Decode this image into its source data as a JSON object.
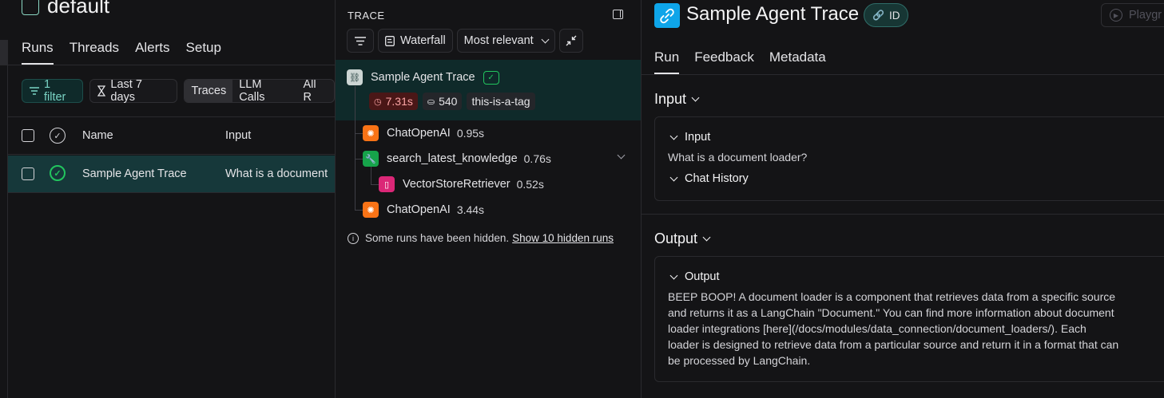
{
  "project": {
    "name": "default"
  },
  "left_tabs": [
    "Runs",
    "Threads",
    "Alerts",
    "Setup"
  ],
  "filters": {
    "filter_label": "1 filter",
    "date_label": "Last 7 days",
    "segments": [
      "Traces",
      "LLM Calls",
      "All R"
    ]
  },
  "table": {
    "headers": {
      "name": "Name",
      "input": "Input"
    },
    "rows": [
      {
        "name": "Sample Agent Trace",
        "input": "What is a document"
      }
    ]
  },
  "trace_panel": {
    "label": "TRACE",
    "view_label": "Waterfall",
    "sort_label": "Most relevant",
    "root": {
      "name": "Sample Agent Trace",
      "latency": "7.31s",
      "tokens": "540",
      "tag": "this-is-a-tag"
    },
    "children": [
      {
        "name": "ChatOpenAI",
        "latency": "0.95s",
        "type": "llm"
      },
      {
        "name": "search_latest_knowledge",
        "latency": "0.76s",
        "type": "tool"
      },
      {
        "name": "VectorStoreRetriever",
        "latency": "0.52s",
        "type": "retriever"
      },
      {
        "name": "ChatOpenAI",
        "latency": "3.44s",
        "type": "llm"
      }
    ],
    "hidden_note": "Some runs have been hidden.",
    "hidden_link": "Show 10 hidden runs"
  },
  "detail": {
    "title": "Sample Agent Trace",
    "id_label": "ID",
    "playground_label": "Playgr",
    "tabs": [
      "Run",
      "Feedback",
      "Metadata"
    ],
    "input_section": {
      "title": "Input",
      "sub_title": "Input",
      "value": "What is a document loader?",
      "chat_history_label": "Chat History"
    },
    "output_section": {
      "title": "Output",
      "sub_title": "Output",
      "lines": [
        "BEEP BOOP! A document loader is a component that retrieves data from a specific source",
        "and returns it as a LangChain \"Document.\" You can find more information about document",
        "loader integrations [here](/docs/modules/data_connection/document_loaders/). Each",
        "loader is designed to retrieve data from a particular source and return it in a format that can",
        "be processed by LangChain."
      ]
    }
  },
  "colors": {
    "accent_teal": "#0f2a2a",
    "selected_row": "#16383a",
    "success": "#22c55e",
    "llm_icon": "#f97316",
    "tool_icon": "#16a34a",
    "retriever_icon": "#db2777",
    "brand_blue": "#0ea5e9"
  }
}
